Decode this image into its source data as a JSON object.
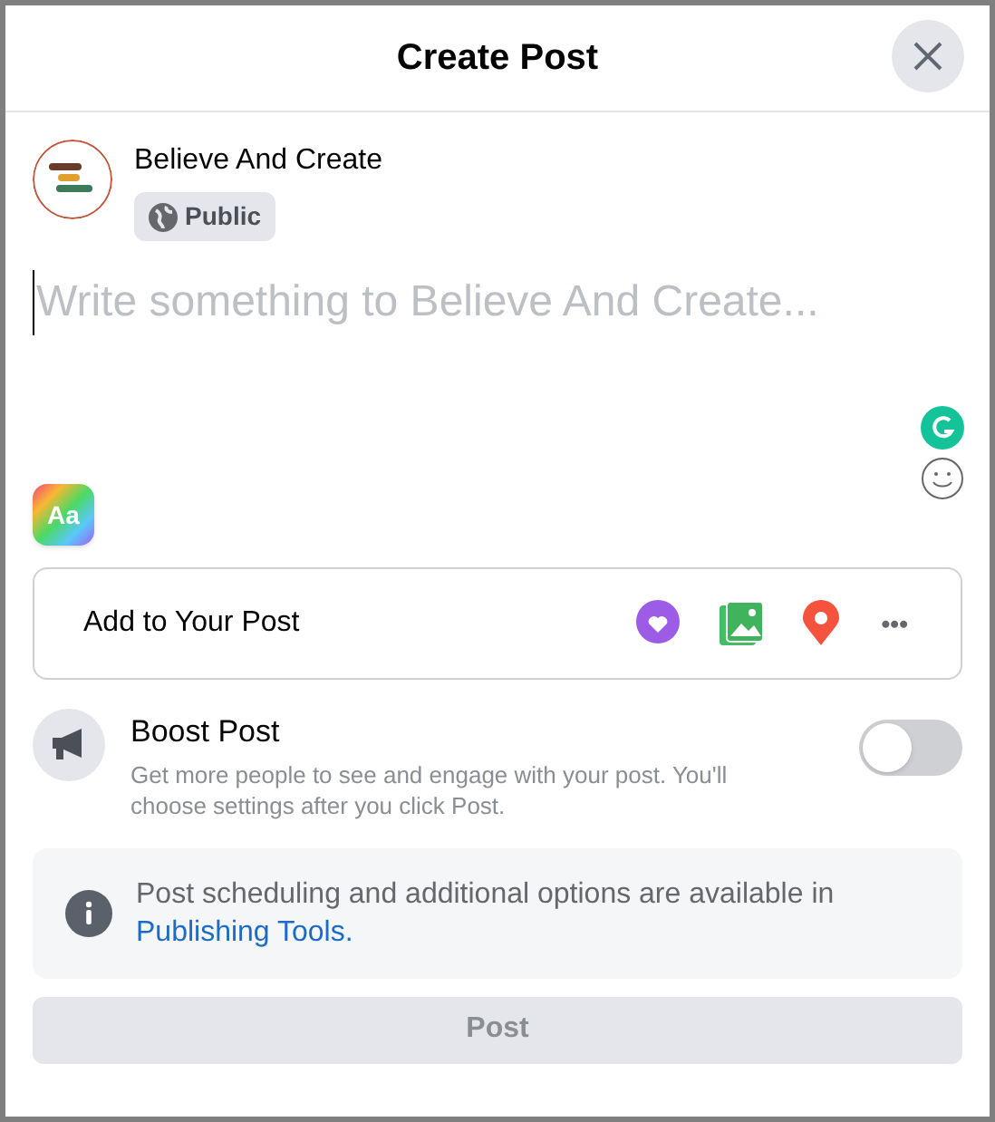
{
  "dialog": {
    "title": "Create Post"
  },
  "author": {
    "name": "Believe And Create",
    "audience": "Public"
  },
  "composer": {
    "placeholder": "Write something to Believe And Create..."
  },
  "text_format": {
    "label": "Aa"
  },
  "add_to_post": {
    "label": "Add to Your Post",
    "more": "•••"
  },
  "boost": {
    "title": "Boost Post",
    "description": "Get more people to see and engage with your post. You'll choose settings after you click Post.",
    "on": false
  },
  "notice": {
    "text": "Post scheduling and additional options are available in",
    "link": "Publishing Tools."
  },
  "post_button": {
    "label": "Post",
    "disabled": true
  }
}
